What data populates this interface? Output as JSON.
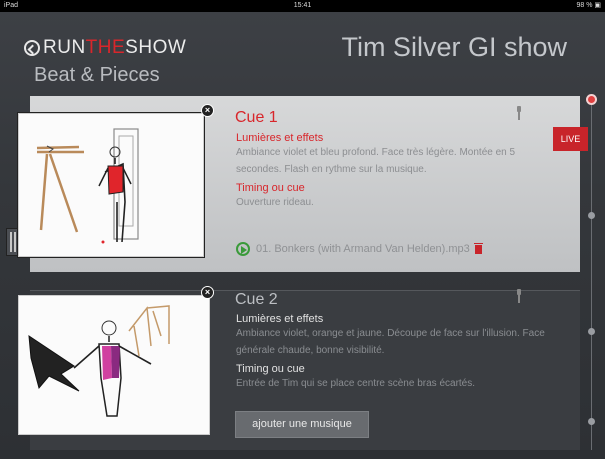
{
  "statusbar": {
    "device": "iPad",
    "time": "15:41",
    "battery": "98 % ▣"
  },
  "header": {
    "logo_a": "RUN",
    "logo_b": "THE",
    "logo_c": "SHOW",
    "subtitle": "Beat & Pieces",
    "show_title": "Tim Silver GI show"
  },
  "colors": {
    "accent": "#d8262b",
    "play": "#3a9a3a",
    "background": "#35383c"
  },
  "cues": [
    {
      "title": "Cue 1",
      "lights_label": "Lumières et effets",
      "lights_desc": "Ambiance violet et bleu profond. Face très légère. Montée en 5 secondes. Flash en rythme sur la musique.",
      "timing_label": "Timing ou cue",
      "timing_desc": "Ouverture rideau.",
      "badge": "LIVE",
      "music": "01. Bonkers (with Armand Van Helden).mp3"
    },
    {
      "title": "Cue 2",
      "lights_label": "Lumières et effets",
      "lights_desc": "Ambiance violet, orange et jaune. Découpe de face sur l'illusion. Face générale chaude, bonne visibilité.",
      "timing_label": "Timing ou cue",
      "timing_desc": "Entrée de Tim qui se place centre scène bras écartés.",
      "add_music_label": "ajouter une musique"
    }
  ],
  "icons": [
    "back-circle-icon",
    "close-icon",
    "pin-icon",
    "play-icon",
    "trash-icon",
    "grip-icon"
  ]
}
